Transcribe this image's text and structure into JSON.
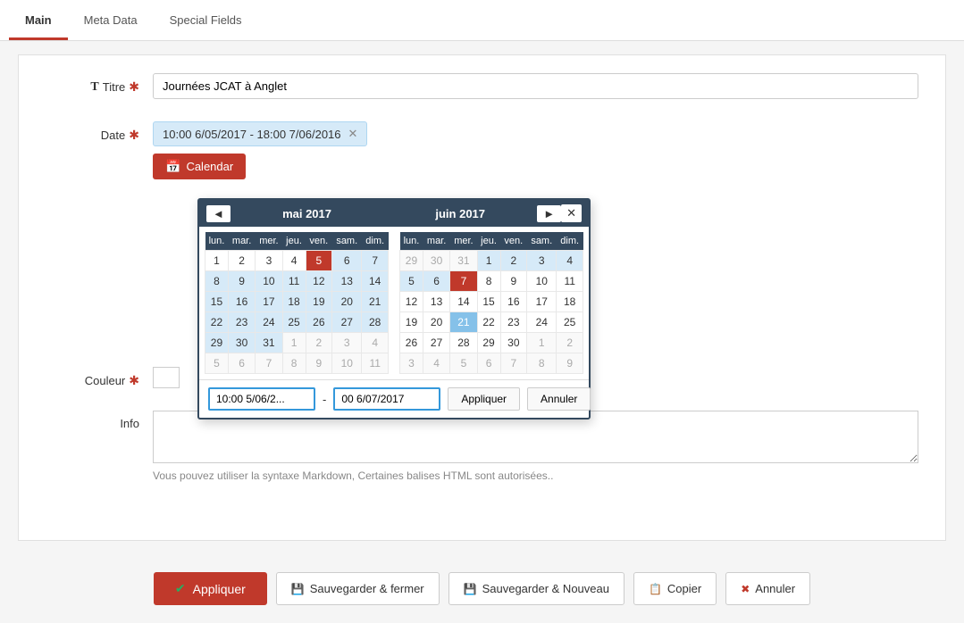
{
  "tabs": [
    {
      "id": "main",
      "label": "Main",
      "active": true
    },
    {
      "id": "meta-data",
      "label": "Meta Data",
      "active": false
    },
    {
      "id": "special-fields",
      "label": "Special Fields",
      "active": false
    }
  ],
  "form": {
    "titre_label": "Titre",
    "titre_icon": "T",
    "titre_value": "Journées JCAT à Anglet",
    "date_label": "Date",
    "date_value": "10:00 6/05/2017 - 18:00 7/06/2016",
    "calendar_btn_label": "Calendar",
    "couleur_label": "Couleur",
    "info_label": "Info",
    "info_note": "Vous pouvez utiliser la syntaxe Markdown, Certaines balises HTML sont autorisées.."
  },
  "calendar": {
    "prev_btn": "◄",
    "next_btn": "►",
    "close_btn": "✕",
    "left_month": "mai 2017",
    "right_month": "juin 2017",
    "day_headers": [
      "lun.",
      "mar.",
      "mer.",
      "jeu.",
      "ven.",
      "sam.",
      "dim."
    ],
    "may_weeks": [
      [
        {
          "day": 1,
          "type": "normal"
        },
        {
          "day": 2,
          "type": "normal"
        },
        {
          "day": 3,
          "type": "normal"
        },
        {
          "day": 4,
          "type": "normal"
        },
        {
          "day": 5,
          "type": "selected-start"
        },
        {
          "day": 6,
          "type": "in-range"
        },
        {
          "day": 7,
          "type": "in-range"
        }
      ],
      [
        {
          "day": 8,
          "type": "in-range"
        },
        {
          "day": 9,
          "type": "in-range"
        },
        {
          "day": 10,
          "type": "in-range"
        },
        {
          "day": 11,
          "type": "in-range"
        },
        {
          "day": 12,
          "type": "in-range"
        },
        {
          "day": 13,
          "type": "in-range"
        },
        {
          "day": 14,
          "type": "in-range"
        }
      ],
      [
        {
          "day": 15,
          "type": "in-range"
        },
        {
          "day": 16,
          "type": "in-range"
        },
        {
          "day": 17,
          "type": "in-range"
        },
        {
          "day": 18,
          "type": "in-range"
        },
        {
          "day": 19,
          "type": "in-range"
        },
        {
          "day": 20,
          "type": "in-range"
        },
        {
          "day": 21,
          "type": "in-range"
        }
      ],
      [
        {
          "day": 22,
          "type": "in-range"
        },
        {
          "day": 23,
          "type": "in-range"
        },
        {
          "day": 24,
          "type": "in-range"
        },
        {
          "day": 25,
          "type": "in-range"
        },
        {
          "day": 26,
          "type": "in-range"
        },
        {
          "day": 27,
          "type": "in-range"
        },
        {
          "day": 28,
          "type": "in-range"
        }
      ],
      [
        {
          "day": 29,
          "type": "in-range"
        },
        {
          "day": 30,
          "type": "in-range"
        },
        {
          "day": 31,
          "type": "in-range"
        },
        {
          "day": 1,
          "type": "other-month"
        },
        {
          "day": 2,
          "type": "other-month"
        },
        {
          "day": 3,
          "type": "other-month"
        },
        {
          "day": 4,
          "type": "other-month"
        }
      ],
      [
        {
          "day": 5,
          "type": "other-month"
        },
        {
          "day": 6,
          "type": "other-month"
        },
        {
          "day": 7,
          "type": "other-month"
        },
        {
          "day": 8,
          "type": "other-month"
        },
        {
          "day": 9,
          "type": "other-month"
        },
        {
          "day": 10,
          "type": "other-month"
        },
        {
          "day": 11,
          "type": "other-month"
        }
      ]
    ],
    "june_weeks": [
      [
        {
          "day": 29,
          "type": "other-month"
        },
        {
          "day": 30,
          "type": "other-month"
        },
        {
          "day": 31,
          "type": "other-month"
        },
        {
          "day": 1,
          "type": "in-range"
        },
        {
          "day": 2,
          "type": "in-range"
        },
        {
          "day": 3,
          "type": "in-range"
        },
        {
          "day": 4,
          "type": "in-range"
        }
      ],
      [
        {
          "day": 5,
          "type": "in-range"
        },
        {
          "day": 6,
          "type": "in-range"
        },
        {
          "day": 7,
          "type": "selected-end"
        },
        {
          "day": 8,
          "type": "normal"
        },
        {
          "day": 9,
          "type": "normal"
        },
        {
          "day": 10,
          "type": "normal"
        },
        {
          "day": 11,
          "type": "normal"
        }
      ],
      [
        {
          "day": 12,
          "type": "normal"
        },
        {
          "day": 13,
          "type": "normal"
        },
        {
          "day": 14,
          "type": "normal"
        },
        {
          "day": 15,
          "type": "normal"
        },
        {
          "day": 16,
          "type": "normal"
        },
        {
          "day": 17,
          "type": "normal"
        },
        {
          "day": 18,
          "type": "normal"
        }
      ],
      [
        {
          "day": 19,
          "type": "normal"
        },
        {
          "day": 20,
          "type": "normal"
        },
        {
          "day": 21,
          "type": "highlighted"
        },
        {
          "day": 22,
          "type": "normal"
        },
        {
          "day": 23,
          "type": "normal"
        },
        {
          "day": 24,
          "type": "normal"
        },
        {
          "day": 25,
          "type": "normal"
        }
      ],
      [
        {
          "day": 26,
          "type": "normal"
        },
        {
          "day": 27,
          "type": "normal"
        },
        {
          "day": 28,
          "type": "normal"
        },
        {
          "day": 29,
          "type": "normal"
        },
        {
          "day": 30,
          "type": "normal"
        },
        {
          "day": 1,
          "type": "other-month"
        },
        {
          "day": 2,
          "type": "other-month"
        }
      ],
      [
        {
          "day": 3,
          "type": "other-month"
        },
        {
          "day": 4,
          "type": "other-month"
        },
        {
          "day": 5,
          "type": "other-month"
        },
        {
          "day": 6,
          "type": "other-month"
        },
        {
          "day": 7,
          "type": "other-month"
        },
        {
          "day": 8,
          "type": "other-month"
        },
        {
          "day": 9,
          "type": "other-month"
        }
      ]
    ],
    "start_input": "10:00 5/06/2...",
    "end_input": "00 6/07/2017",
    "apply_btn": "Appliquer",
    "cancel_btn": "Annuler"
  },
  "toolbar": {
    "apply_label": "Appliquer",
    "save_close_label": "Sauvegarder & fermer",
    "save_new_label": "Sauvegarder & Nouveau",
    "copy_label": "Copier",
    "cancel_label": "Annuler"
  }
}
